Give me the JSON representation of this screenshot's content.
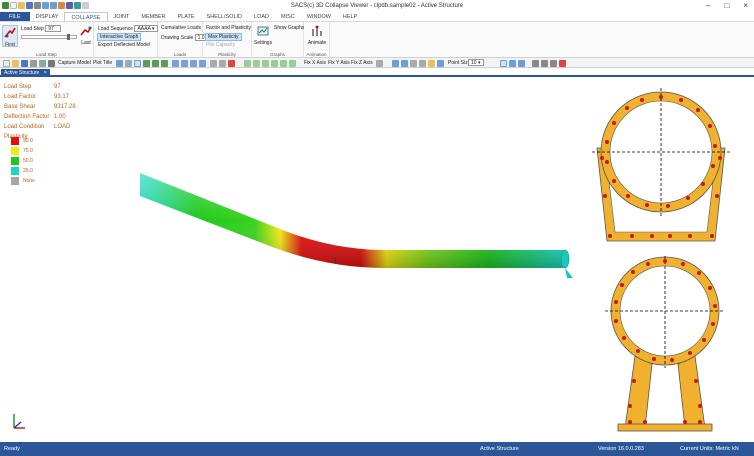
{
  "window": {
    "title": "SACS(c) 3D Collapse Viewer - clpdb.sample02 - Active Structure",
    "controls": [
      "–",
      "□",
      "×"
    ]
  },
  "menu": [
    "FILE",
    "DISPLAY",
    "COLLAPSE",
    "JOINT",
    "MEMBER",
    "PLATE",
    "SHELL/SOLID",
    "LOAD",
    "MISC",
    "WINDOW",
    "HELP"
  ],
  "menu_active": "COLLAPSE",
  "ribbon": {
    "first_label": "First",
    "last_label": "Last",
    "load_step_label": "Load Step",
    "load_step_value": "97",
    "load_step_group": "Load Step",
    "load_sequence_label": "Load Sequence",
    "load_sequence_value": "AAAA",
    "interactive_graph": "Interactive Graph",
    "export_deflected": "Export Deflected Model",
    "cumulative_loads": "Cumulative Loads",
    "drawing_scale_label": "Drawing Scale",
    "drawing_scale_value": "1.0",
    "loads_group": "Loads",
    "factor_plasticity": "Factor and Plasticity",
    "max_plasticity": "Max Plasticity",
    "pile_capacity": "Pile Capacity",
    "plasticity_group": "Plasticity",
    "settings": "Settings",
    "show_graphs": "Show Graphs",
    "graphs_group": "Graphs",
    "animate": "Animate",
    "animation_group": "Animation"
  },
  "toolbar": {
    "capture_model": "Capture Model",
    "plot_title": "Plot Title",
    "fix_x": "Fix X Axis",
    "fix_y": "Fix Y Axis",
    "fix_z": "Fix Z Axis",
    "point_size_label": "Point Size",
    "point_size_value": "10"
  },
  "tab": "Active Structure",
  "info": [
    {
      "label": "Load Step",
      "value": "97"
    },
    {
      "label": "Load Factor",
      "value": "93.17"
    },
    {
      "label": "Base Shear",
      "value": "9317.28"
    },
    {
      "label": "Deflection Factor",
      "value": "1.00"
    },
    {
      "label": "Load Condition",
      "value": "LOAD"
    }
  ],
  "plasticity_title": "Plasticity",
  "legend": [
    {
      "label": "90.0",
      "color": "#e01010"
    },
    {
      "label": "75.0",
      "color": "#f2ea12"
    },
    {
      "label": "50.0",
      "color": "#1ec81e"
    },
    {
      "label": "25.0",
      "color": "#19d6c6"
    },
    {
      "label": "None",
      "color": "#a6a6a6"
    }
  ],
  "status": {
    "left": "Ready",
    "center": "Active Structure",
    "version": "Version 16.0.0.283",
    "units": "Current Units: Metric kN"
  },
  "colors": {
    "accent": "#2b579a",
    "section_fill": "#f0b12e",
    "section_dot": "#c41a1a"
  }
}
